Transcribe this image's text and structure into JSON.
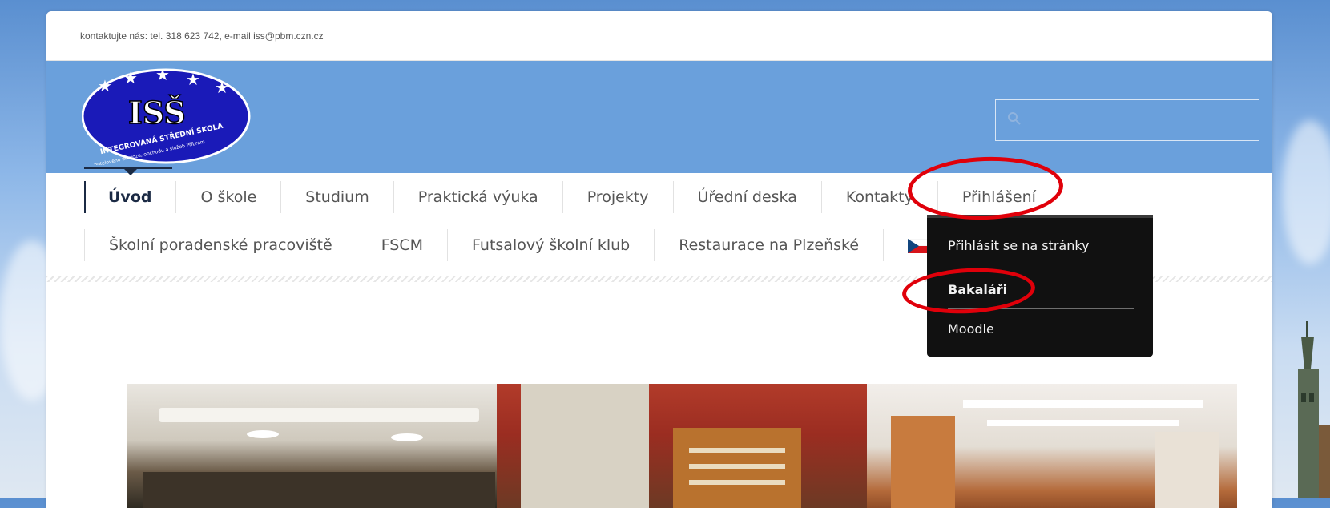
{
  "topbar": {
    "contact": "kontaktujte nás: tel. 318 623 742, e-mail iss@pbm.czn.cz"
  },
  "logo": {
    "main": "ISŠ",
    "ring_text": "INTEGROVANÁ STŘEDNÍ ŠKOLA",
    "sub_text": "hotelového provozu, obchodu a služeb Příbram"
  },
  "search": {
    "placeholder": ""
  },
  "nav": {
    "row1": [
      "Úvod",
      "O škole",
      "Studium",
      "Praktická výuka",
      "Projekty",
      "Úřední deska",
      "Kontakty",
      "Přihlášení"
    ],
    "row2": [
      "Školní poradenské pracoviště",
      "FSCM",
      "Futsalový školní klub",
      "Restaurace na Plzeňské"
    ]
  },
  "dropdown": {
    "items": [
      "Přihlásit se na stránky",
      "Bakaláři",
      "Moodle"
    ]
  },
  "colors": {
    "header_blue": "#6aa0dc",
    "nav_active": "#1b2a44",
    "dropdown_bg": "#111111",
    "annotation_red": "#e0000a"
  }
}
